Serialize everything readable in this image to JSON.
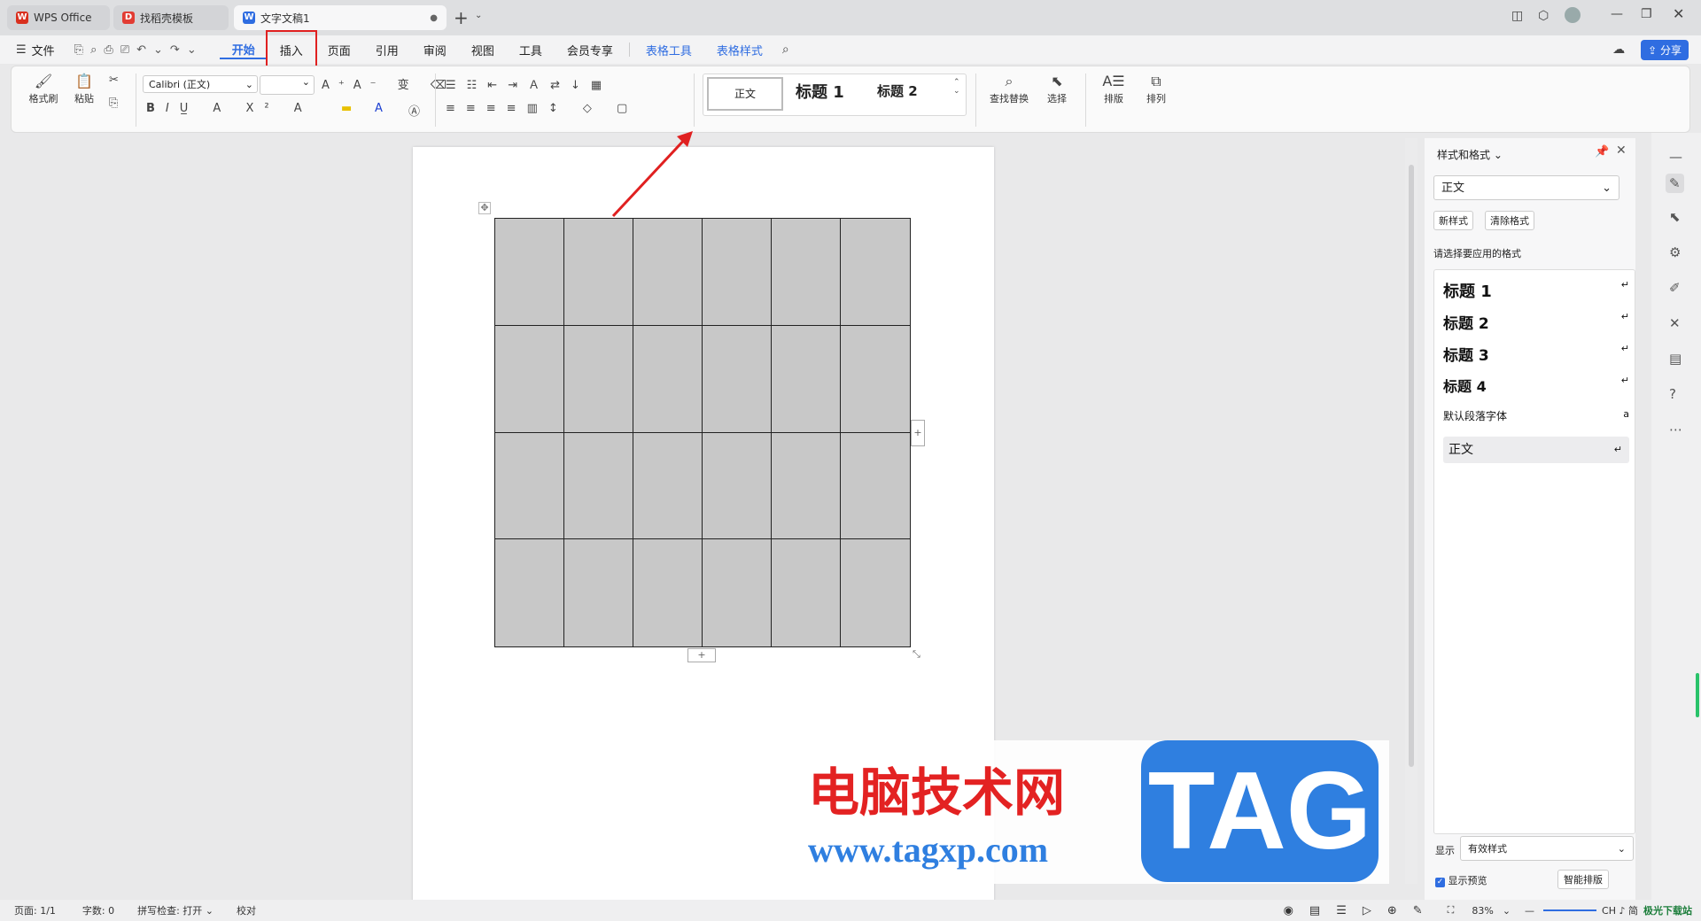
{
  "tabs": [
    {
      "label": "WPS Office",
      "icon": "wps-logo-icon",
      "color": "#d9301f"
    },
    {
      "label": "找稻壳模板",
      "icon": "docer-icon",
      "color": "#e23c33"
    },
    {
      "label": "文字文稿1",
      "icon": "word-doc-icon",
      "color": "#2f6de1"
    }
  ],
  "menu": {
    "file": "文件",
    "items": [
      "开始",
      "插入",
      "页面",
      "引用",
      "审阅",
      "视图",
      "工具",
      "会员专享"
    ],
    "context_items": [
      "表格工具",
      "表格样式"
    ],
    "active": "开始",
    "share": "分享"
  },
  "ribbon": {
    "format_painter": "格式刷",
    "paste": "粘贴",
    "font_name": "Calibri (正文)",
    "font_size": "",
    "styles": [
      "正文",
      "标题 1",
      "标题 2"
    ],
    "find_replace": "查找替换",
    "select": "选择",
    "layout": "排版",
    "arrange": "排列"
  },
  "side_panel": {
    "title": "样式和格式",
    "current_style": "正文",
    "new_style": "新样式",
    "clear_format": "清除格式",
    "prompt": "请选择要应用的格式",
    "styles": [
      "标题 1",
      "标题 2",
      "标题 3",
      "标题 4",
      "默认段落字体",
      "正文"
    ],
    "show_label": "显示",
    "show_value": "有效样式",
    "preview_label": "显示预览",
    "smart_layout": "智能排版"
  },
  "watermark": {
    "title": "电脑技术网",
    "url": "www.tagxp.com",
    "logo": "TAG",
    "corner": "极光下载站"
  },
  "status": {
    "page": "页面: 1/1",
    "words": "字数: 0",
    "spell": "拼写检查: 打开",
    "proof": "校对",
    "zoom": "83%",
    "ime": "CH ♪ 简"
  },
  "colors": {
    "accent": "#2f6de1",
    "highlight_box": "#e02020",
    "watermark_red": "#e32222",
    "watermark_blue": "#2f7fe0"
  }
}
